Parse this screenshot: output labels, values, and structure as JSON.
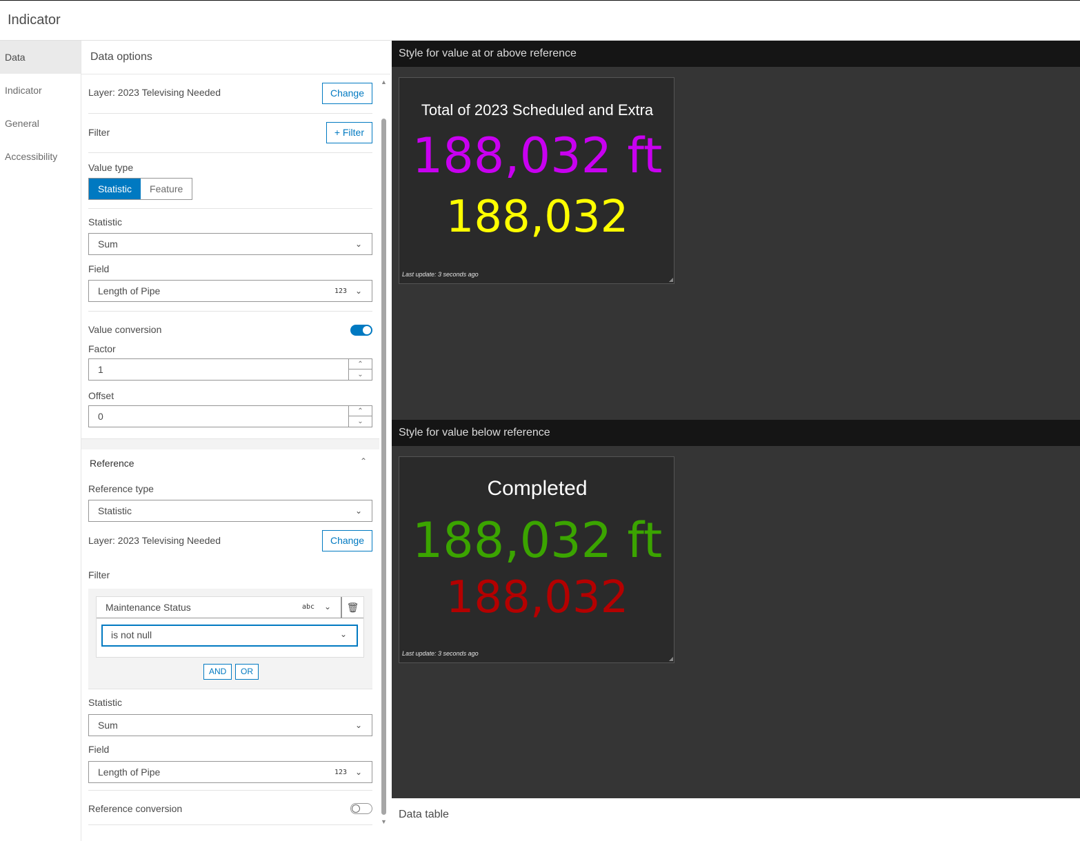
{
  "app": {
    "title": "Indicator"
  },
  "nav": {
    "items": [
      "Data",
      "Indicator",
      "General",
      "Accessibility"
    ]
  },
  "panel": {
    "header": "Data options",
    "layer_label": "Layer: 2023 Televising Needed",
    "change_label": "Change",
    "filter_label": "Filter",
    "add_filter_label": "+ Filter",
    "value_type_label": "Value type",
    "value_type_options": [
      "Statistic",
      "Feature"
    ],
    "statistic_label": "Statistic",
    "statistic_value": "Sum",
    "field_label": "Field",
    "field_value": "Length of Pipe",
    "field_type_badge": "123",
    "value_conversion_label": "Value conversion",
    "factor_label": "Factor",
    "factor_value": "1",
    "offset_label": "Offset",
    "offset_value": "0"
  },
  "reference": {
    "header": "Reference",
    "type_label": "Reference type",
    "type_value": "Statistic",
    "layer_label": "Layer: 2023 Televising Needed",
    "change_label": "Change",
    "filter_label": "Filter",
    "filter_field": "Maintenance Status",
    "filter_field_badge": "abc",
    "filter_operator": "is not null",
    "and_label": "AND",
    "or_label": "OR",
    "statistic_label": "Statistic",
    "statistic_value": "Sum",
    "field_label": "Field",
    "field_value": "Length of Pipe",
    "field_type_badge": "123",
    "conversion_label": "Reference conversion"
  },
  "preview": {
    "above_label": "Style for value at or above reference",
    "below_label": "Style for value below reference",
    "data_table_label": "Data table",
    "card_above": {
      "title": "Total of 2023 Scheduled and Extra",
      "value": "188,032 ft",
      "reference": "188,032",
      "value_color": "#c800f0",
      "reference_color": "#ffff00",
      "footer": "Last update: 3 seconds ago"
    },
    "card_below": {
      "title": "Completed",
      "value": "188,032 ft",
      "reference": "188,032",
      "value_color": "#3ba400",
      "reference_color": "#b40000",
      "footer": "Last update: 3 seconds ago"
    }
  },
  "colors": {
    "accent": "#0079c1"
  }
}
